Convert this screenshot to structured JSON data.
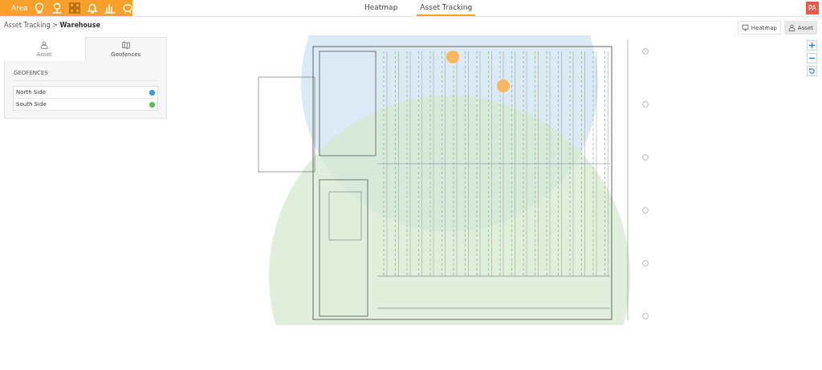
{
  "top_bar": {
    "area_label": "Area",
    "nav_tabs": [
      {
        "label": "Heatmap",
        "selected": false
      },
      {
        "label": "Asset Tracking",
        "selected": true
      }
    ],
    "user_initials": "PA"
  },
  "breadcrumb": {
    "parent": "Asset Tracking",
    "separator": ">",
    "current": "Warehouse"
  },
  "panel_tabs": [
    {
      "label": "Asset",
      "selected": false
    },
    {
      "label": "Geofences",
      "selected": true
    }
  ],
  "geofences": {
    "heading": "GEOFENCES",
    "items": [
      {
        "name": "North Side",
        "color": "#3a97d4"
      },
      {
        "name": "South Side",
        "color": "#5cb85c"
      }
    ]
  },
  "view_toggle": [
    {
      "label": "Heatmap",
      "selected": false
    },
    {
      "label": "Asset",
      "selected": true
    }
  ]
}
